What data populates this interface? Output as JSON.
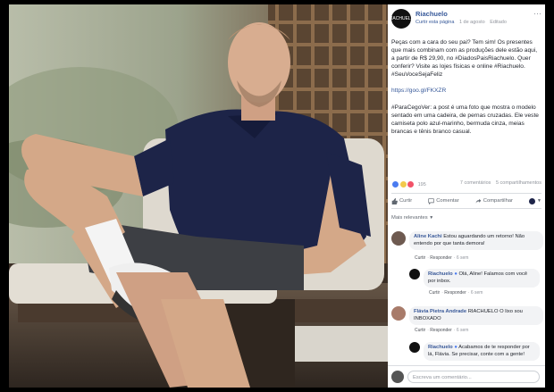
{
  "page": {
    "name": "Riachuelo",
    "logo_text": "RIACHUELO",
    "meta": [
      "Curtir esta página",
      "1 de agosto",
      "Editado"
    ]
  },
  "post": {
    "p1": "Peças com a cara do seu pai? Tem sim! Os presentes que mais combinam com as produções dele estão aqui, a partir de R$ 29,90, no #DiadosPaisRiachuelo. Quer conferir? Visite as lojes físicas e online #Riachuelo. #SeuVoceSejaFeliz",
    "p2": "https://goo.gl/FKXZR",
    "p3": "#ParaCegoVer: a post é uma foto que mostra o modelo sentado em uma cadeira, de pernas cruzadas. Ele veste camiseta polo azul-marinho, bermuda cinza, meias brancas e tênis branco casual."
  },
  "stats": {
    "reactions": "195",
    "comments": "7 comentários",
    "shares": "5 compartilhamentos"
  },
  "actions": {
    "like": "Curtir",
    "comment": "Comentar",
    "share": "Compartilhar"
  },
  "filter_label": "Mais relevantes",
  "comments": [
    {
      "author": "Aline Kachi",
      "text": "Estou aguardando um retorno! Não entendo por que tanta demora!",
      "actions": [
        "Curtir",
        "Responder",
        "6 sem"
      ]
    },
    {
      "author": "Riachuelo",
      "text": "Olá, Aline! Falamos com você por inbox.",
      "actions": [
        "Curtir",
        "Responder",
        "6 sem"
      ]
    },
    {
      "author": "Flávia Pietra Andrade",
      "text": "RIACHUELO O lixo sou INBOXADO",
      "actions": [
        "Curtir",
        "Responder",
        "6 sem"
      ]
    },
    {
      "author": "Riachuelo",
      "text": "Acabamos de te responder por lá, Flávia. Se precisar, conte com a gente!",
      "actions": []
    }
  ],
  "composer": {
    "placeholder": "Escreva um comentário..."
  },
  "colors": {
    "link": "#365899",
    "muted": "#90949c",
    "bubble": "#f2f3f5",
    "shirt": "#1d2448",
    "like": "#4a7bf0"
  }
}
